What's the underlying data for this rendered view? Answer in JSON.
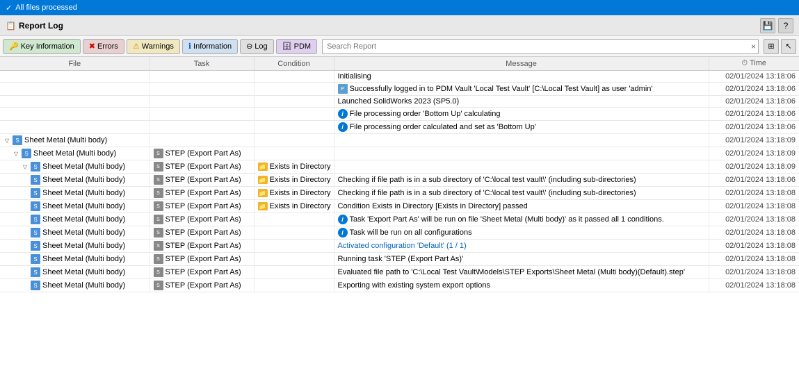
{
  "topbar": {
    "label": "All files processed",
    "icon": "checkmark-icon"
  },
  "reportLog": {
    "title": "Report Log",
    "title_icon": "report-icon",
    "save_button_label": "💾",
    "help_button_label": "?"
  },
  "toolbar": {
    "buttons": [
      {
        "id": "key-info",
        "label": "Key Information",
        "icon": "key-icon",
        "class": "key"
      },
      {
        "id": "errors",
        "label": "Errors",
        "icon": "error-icon",
        "class": "errors"
      },
      {
        "id": "warnings",
        "label": "Warnings",
        "icon": "warning-icon",
        "class": "warnings"
      },
      {
        "id": "information",
        "label": "Information",
        "icon": "info-icon",
        "class": "info"
      },
      {
        "id": "log",
        "label": "Log",
        "icon": "log-icon",
        "class": "log"
      },
      {
        "id": "pdm",
        "label": "PDM",
        "icon": "pdm-icon",
        "class": "pdm"
      }
    ],
    "search_placeholder": "Search Report",
    "clear_icon": "×",
    "columns_icon": "⊞"
  },
  "table": {
    "columns": [
      "File",
      "Task",
      "Condition",
      "Message",
      "⏱ Time"
    ],
    "rows": [
      {
        "indent": 0,
        "file": "",
        "file_icon": "",
        "task": "",
        "task_icon": "",
        "condition": "",
        "condition_icon": "",
        "msg_icon": "",
        "message": "Initialising",
        "time": "02/01/2024 13:18:06"
      },
      {
        "indent": 0,
        "file": "",
        "file_icon": "",
        "task": "",
        "task_icon": "",
        "condition": "",
        "condition_icon": "",
        "msg_icon": "pdm",
        "message": "Successfully logged in to PDM Vault 'Local Test Vault' [C:\\Local Test Vault] as user 'admin'",
        "time": "02/01/2024 13:18:06"
      },
      {
        "indent": 0,
        "file": "",
        "file_icon": "",
        "task": "",
        "task_icon": "",
        "condition": "",
        "condition_icon": "",
        "msg_icon": "",
        "message": "Launched SolidWorks 2023 (SP5.0)",
        "time": "02/01/2024 13:18:06"
      },
      {
        "indent": 0,
        "file": "",
        "file_icon": "",
        "task": "",
        "task_icon": "",
        "condition": "",
        "condition_icon": "",
        "msg_icon": "info",
        "message": "File processing order 'Bottom Up' calculating",
        "time": "02/01/2024 13:18:06"
      },
      {
        "indent": 0,
        "file": "",
        "file_icon": "",
        "task": "",
        "task_icon": "",
        "condition": "",
        "condition_icon": "",
        "msg_icon": "info",
        "message": "File processing order calculated and set as 'Bottom Up'",
        "time": "02/01/2024 13:18:06"
      },
      {
        "indent": 0,
        "file": "",
        "file_icon": "",
        "task": "",
        "task_icon": "",
        "condition": "",
        "condition_icon": "",
        "msg_icon": "",
        "message": "",
        "time": "02/01/2024 13:18:09",
        "expand": true,
        "file_label": "Sheet Metal (Multi body)",
        "file_icon_type": "sheet-metal"
      },
      {
        "indent": 1,
        "expand": true,
        "file_label": "Sheet Metal (Multi body)",
        "file_icon_type": "sheet-metal",
        "task_label": "STEP (Export Part As)",
        "task_icon_type": "step",
        "condition": "",
        "condition_icon": "",
        "msg_icon": "",
        "message": "",
        "time": "02/01/2024 13:18:09"
      },
      {
        "indent": 2,
        "expand": true,
        "file_label": "Sheet Metal (Multi body)",
        "file_icon_type": "sheet-metal",
        "task_label": "STEP (Export Part As)",
        "task_icon_type": "step",
        "condition_label": "Exists in Directory",
        "condition_icon_type": "folder",
        "msg_icon": "",
        "message": "",
        "time": "02/01/2024 13:18:09"
      },
      {
        "indent": 3,
        "file_label": "Sheet Metal (Multi body)",
        "file_icon_type": "sheet-metal",
        "task_label": "STEP (Export Part As)",
        "task_icon_type": "step",
        "condition_label": "Exists in Directory",
        "condition_icon_type": "folder",
        "msg_icon": "",
        "message": "Checking if file path is in a sub directory of 'C:\\local test vault\\' (including sub-directories)",
        "time": "02/01/2024 13:18:06"
      },
      {
        "indent": 3,
        "file_label": "Sheet Metal (Multi body)",
        "file_icon_type": "sheet-metal",
        "task_label": "STEP (Export Part As)",
        "task_icon_type": "step",
        "condition_label": "Exists in Directory",
        "condition_icon_type": "folder",
        "msg_icon": "",
        "message": "Checking if file path is in a sub directory of 'C:\\local test vault\\' (including sub-directories)",
        "time": "02/01/2024 13:18:08"
      },
      {
        "indent": 3,
        "file_label": "Sheet Metal (Multi body)",
        "file_icon_type": "sheet-metal",
        "task_label": "STEP (Export Part As)",
        "task_icon_type": "step",
        "condition_label": "Exists in Directory",
        "condition_icon_type": "folder",
        "msg_icon": "",
        "message": "Condition Exists in Directory [Exists in Directory] passed",
        "time": "02/01/2024 13:18:08"
      },
      {
        "indent": 3,
        "file_label": "Sheet Metal (Multi body)",
        "file_icon_type": "sheet-metal",
        "task_label": "STEP (Export Part As)",
        "task_icon_type": "step",
        "condition_label": "",
        "condition_icon": "",
        "msg_icon": "info",
        "message": "Task 'Export Part As' will be run on file 'Sheet Metal (Multi body)' as it passed all 1 conditions.",
        "time": "02/01/2024 13:18:08"
      },
      {
        "indent": 3,
        "file_label": "Sheet Metal (Multi body)",
        "file_icon_type": "sheet-metal",
        "task_label": "STEP (Export Part As)",
        "task_icon_type": "step",
        "condition_label": "",
        "condition_icon": "",
        "msg_icon": "info",
        "message": "Task will be run on all configurations",
        "time": "02/01/2024 13:18:08"
      },
      {
        "indent": 3,
        "file_label": "Sheet Metal (Multi body)",
        "file_icon_type": "sheet-metal",
        "task_label": "STEP (Export Part As)",
        "task_icon_type": "step",
        "condition_label": "",
        "condition_icon": "",
        "msg_icon": "",
        "message": "Activated configuration 'Default' (1 / 1)",
        "time": "02/01/2024 13:18:08",
        "message_blue": true
      },
      {
        "indent": 3,
        "file_label": "Sheet Metal (Multi body)",
        "file_icon_type": "sheet-metal",
        "task_label": "STEP (Export Part As)",
        "task_icon_type": "step",
        "condition_label": "",
        "condition_icon": "",
        "msg_icon": "",
        "message": "Running task 'STEP (Export Part As)'",
        "time": "02/01/2024 13:18:08"
      },
      {
        "indent": 3,
        "file_label": "Sheet Metal (Multi body)",
        "file_icon_type": "sheet-metal",
        "task_label": "STEP (Export Part As)",
        "task_icon_type": "step",
        "condition_label": "",
        "condition_icon": "",
        "msg_icon": "",
        "message": "Evaluated file path to 'C:\\Local Test Vault\\Models\\STEP Exports\\Sheet Metal (Multi body)(Default).step'",
        "time": "02/01/2024 13:18:08"
      },
      {
        "indent": 3,
        "file_label": "Sheet Metal (Multi body)",
        "file_icon_type": "sheet-metal",
        "task_label": "STEP (Export Part As)",
        "task_icon_type": "step",
        "condition_label": "",
        "condition_icon": "",
        "msg_icon": "",
        "message": "Exporting with existing system export options",
        "time": "02/01/2024 13:18:08"
      }
    ]
  }
}
